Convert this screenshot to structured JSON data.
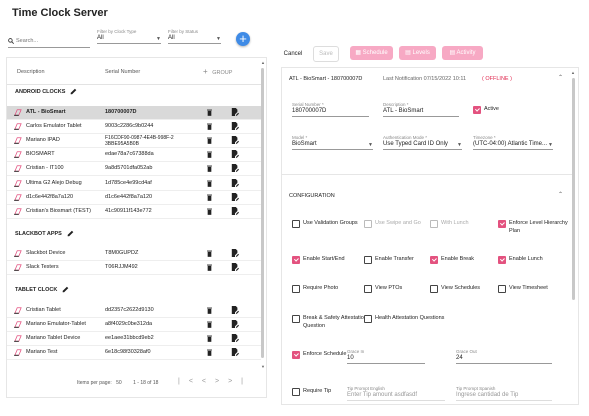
{
  "app": {
    "title": "Time Clock Server"
  },
  "filters": {
    "search_placeholder": "Search...",
    "clock_type_label": "Filter by Clock Type",
    "clock_type_value": "All",
    "status_label": "Filter by Status",
    "status_value": "All",
    "add_symbol": "+"
  },
  "table": {
    "col_description": "Description",
    "col_serial": "Serial Number",
    "group_label": "GROUP",
    "plus": "+",
    "groups": [
      {
        "name": "ANDROID CLOCKS",
        "rows": [
          {
            "description": "ATL - BioSmart",
            "serial": "180700007D",
            "selected": true
          },
          {
            "description": "Carlos Emulator Tablet",
            "serial": "9003c2286c9b0244"
          },
          {
            "description": "Mariano IPAD",
            "serial": "F16CDF90-0987-4E4B-998F-23BBE95A5B0B"
          },
          {
            "description": "BIOSMART",
            "serial": "edae78a7c67388da"
          },
          {
            "description": "Cristian - IT100",
            "serial": "9a8d5701dfa052ab"
          },
          {
            "description": "Ultima G2 Alejo Debug",
            "serial": "1d785ce4e99cd4af"
          },
          {
            "description": "d1c6e442f8a7a120",
            "serial": "d1c6e442f8a7a120"
          },
          {
            "description": "Cristian's Biosmart (TEST)",
            "serial": "41c90911f143e772"
          }
        ]
      },
      {
        "name": "SLACKBOT APPS",
        "rows": [
          {
            "description": "Slackbot Device",
            "serial": "T8M0GUPDZ"
          },
          {
            "description": "Slack Testers",
            "serial": "T06RJJM492"
          }
        ]
      },
      {
        "name": "TABLET CLOCK",
        "rows": [
          {
            "description": "Cristian Tablet",
            "serial": "dd2357c2622d9130"
          },
          {
            "description": "Mariano Emulator-Tablet",
            "serial": "a8f4029c0be312da"
          },
          {
            "description": "Mariano Tablet Device",
            "serial": "ee1aee31bbcd9eb2"
          },
          {
            "description": "Mariano Test",
            "serial": "6e18c98f30328af0"
          }
        ]
      }
    ]
  },
  "pager": {
    "items_label": "Items per page:",
    "items_value": "50",
    "range": "1 - 18 of 18",
    "first": "|<",
    "prev": "<",
    "next": ">",
    "last": ">|"
  },
  "toolbar": {
    "cancel": "Cancel",
    "save": "Save",
    "schedule": "Schedule",
    "levels": "Levels",
    "activity": "Activity"
  },
  "detail": {
    "header_name": "ATL - BioSmart - 180700007D",
    "last_notification": "Last Notification 07/15/2022 10:11",
    "status": "( OFFLINE )",
    "serial_label": "Serial Number *",
    "serial_value": "180700007D",
    "description_label": "Description *",
    "description_value": "ATL - BioSmart",
    "active_label": "Active",
    "model_label": "Model *",
    "model_value": "BioSmart",
    "auth_label": "Authentication Mode *",
    "auth_value": "Use Typed Card ID Only",
    "timezone_label": "Timezone *",
    "timezone_value": "(UTC-04:00) Atlantic Time..."
  },
  "config": {
    "title": "CONFIGURATION",
    "options": [
      {
        "label": "Use Validation Groups",
        "checked": false,
        "disabled": false
      },
      {
        "label": "Use Swipe and Go",
        "checked": false,
        "disabled": true
      },
      {
        "label": "With Lunch",
        "checked": false,
        "disabled": true
      },
      {
        "label": "Enforce Level Hierarchy Plan",
        "checked": true,
        "disabled": false
      },
      {
        "label": "Enable Start/End",
        "checked": true,
        "disabled": false
      },
      {
        "label": "Enable Transfer",
        "checked": false,
        "disabled": false
      },
      {
        "label": "Enable Break",
        "checked": true,
        "disabled": false
      },
      {
        "label": "Enable Lunch",
        "checked": true,
        "disabled": false
      },
      {
        "label": "Require Photo",
        "checked": false,
        "disabled": false
      },
      {
        "label": "View PTOs",
        "checked": false,
        "disabled": false
      },
      {
        "label": "View Schedules",
        "checked": false,
        "disabled": false
      },
      {
        "label": "View Timesheet",
        "checked": false,
        "disabled": false
      },
      {
        "label": "Break & Safety Attestation Question",
        "checked": false,
        "disabled": false
      },
      {
        "label": "Health Attestation Questions",
        "checked": false,
        "disabled": false
      },
      {
        "label": "Enforce Schedule",
        "checked": true,
        "disabled": false
      },
      {
        "label": "Require Tip",
        "checked": false,
        "disabled": false
      }
    ],
    "grace_in_label": "Grace In",
    "grace_in_value": "10",
    "grace_out_label": "Grace Out",
    "grace_out_value": "24",
    "tip_en_label": "Tip Prompt English",
    "tip_en_value": "Enter Tip amount asdfasdf",
    "tip_es_label": "Tip Prompt Spanish",
    "tip_es_value": "Ingrese cantidad de Tip"
  },
  "colors": {
    "accent": "#3f8be6",
    "pink": "#e3527f",
    "offline": "#e0284f",
    "selected_row": "#d9d9d9"
  }
}
